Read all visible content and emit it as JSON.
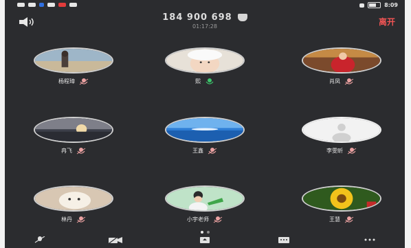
{
  "header": {
    "meeting_id": "184 900 698",
    "elapsed": "01:17:28",
    "leave_label": "离开"
  },
  "status_bar": {
    "time": "8:09"
  },
  "participants": [
    {
      "name": "杨程璋",
      "avatar": "beach-scene",
      "mic": "muted"
    },
    {
      "name": "熙",
      "avatar": "baby-photo",
      "mic": "active"
    },
    {
      "name": "肖凤",
      "avatar": "red-dress-photo",
      "mic": "muted"
    },
    {
      "name": "冉飞",
      "avatar": "sunset-photo",
      "mic": "muted"
    },
    {
      "name": "王鑫",
      "avatar": "ocean-photo",
      "mic": "muted"
    },
    {
      "name": "李雯昕",
      "avatar": "default-person",
      "mic": "muted"
    },
    {
      "name": "林丹",
      "avatar": "dog-photo",
      "mic": "muted"
    },
    {
      "name": "小宇老师",
      "avatar": "child-photo",
      "mic": "muted"
    },
    {
      "name": "王慧",
      "avatar": "sunflower-photo",
      "mic": "muted"
    }
  ],
  "colors": {
    "background": "#2b2c2f",
    "leave": "#f05454",
    "mic_muted": "#e9a0a0",
    "mic_active": "#3cc46b"
  }
}
